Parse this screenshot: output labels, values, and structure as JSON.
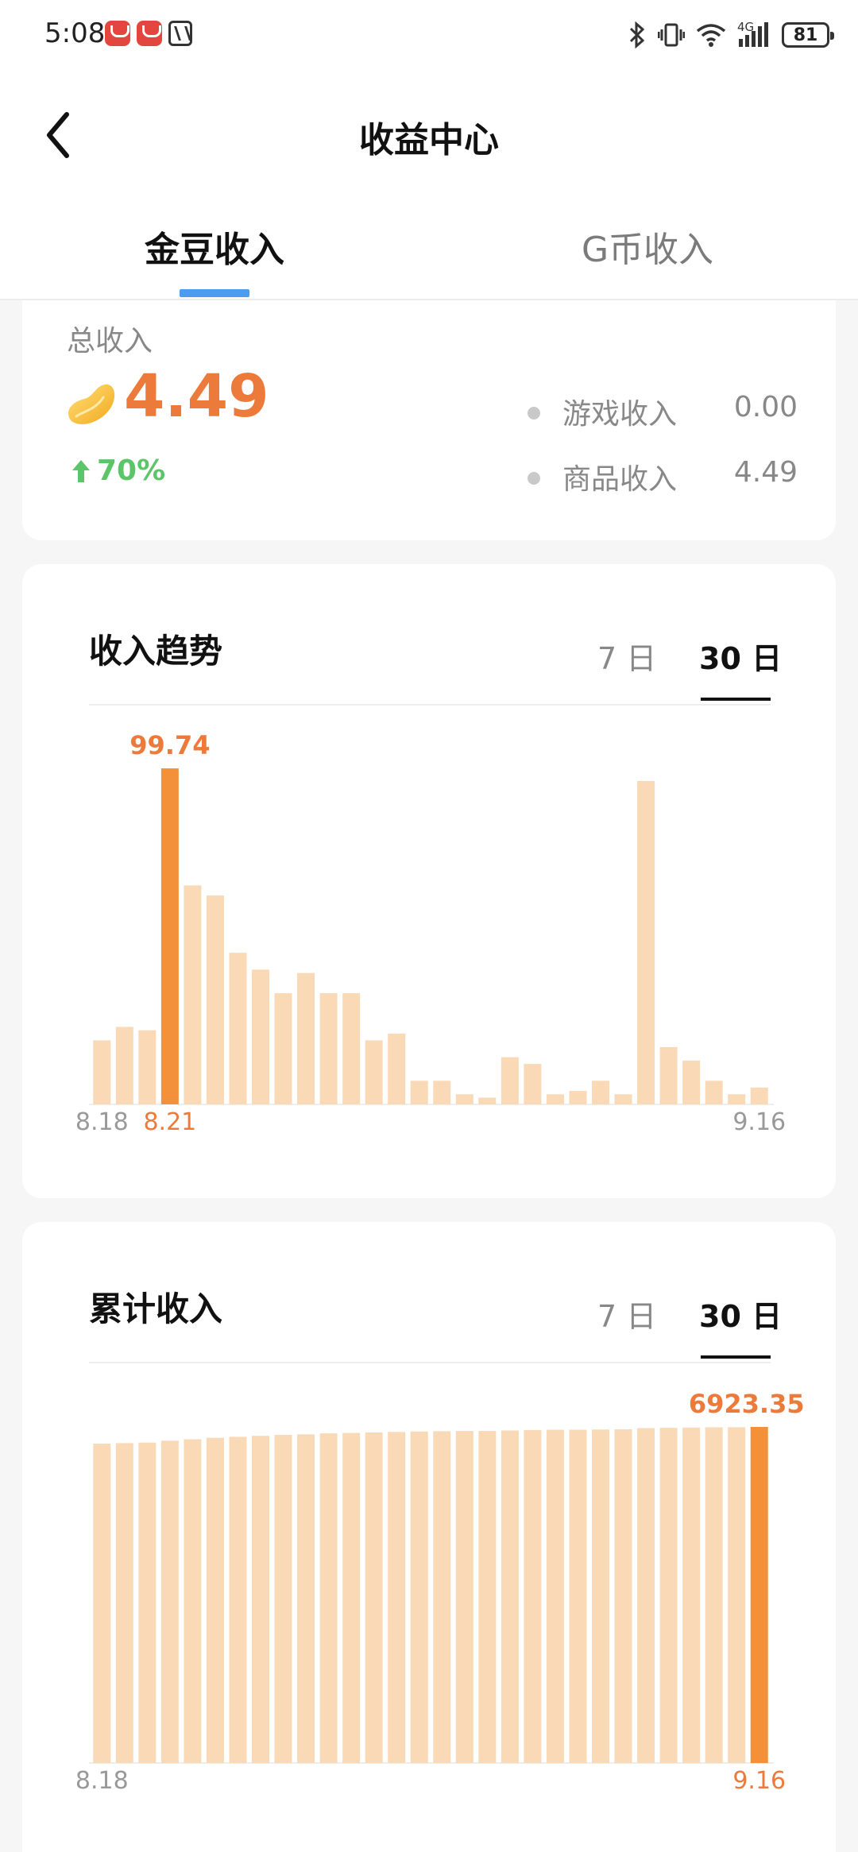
{
  "status_bar": {
    "time": "5:08",
    "network": "4G",
    "battery": "81",
    "icons": [
      "app-icon",
      "app-icon",
      "nfc-icon",
      "bluetooth-icon",
      "vibrate-icon",
      "wifi-icon",
      "signal-icon",
      "battery-icon"
    ]
  },
  "header": {
    "title": "收益中心",
    "back_icon": "chevron-left-icon"
  },
  "tabs": [
    {
      "label": "金豆收入",
      "active": true
    },
    {
      "label": "G币收入",
      "active": false
    }
  ],
  "summary": {
    "total_label": "总收入",
    "total_value": "4.49",
    "growth": "70%",
    "breakdown": [
      {
        "label": "游戏收入",
        "value": "0.00"
      },
      {
        "label": "商品收入",
        "value": "4.49"
      }
    ]
  },
  "trend": {
    "title": "收入趋势",
    "range_options": [
      "7 日",
      "30 日"
    ],
    "selected_range": "30 日"
  },
  "cumulative": {
    "title": "累计收入",
    "range_options": [
      "7 日",
      "30 日"
    ],
    "selected_range": "30 日"
  },
  "colors": {
    "accent": "#ec7a3a",
    "bar_highlight": "#f2913a",
    "bar": "#fad9b6",
    "tab_indicator": "#4a9df0",
    "growth": "#5cc56a"
  },
  "chart_data": [
    {
      "type": "bar",
      "title": "收入趋势",
      "x_start_label": "8.18",
      "x_end_label": "9.16",
      "highlight_index": 3,
      "highlight_label": "8.21",
      "highlight_value_label": "99.74",
      "values": [
        19,
        23,
        22,
        99.74,
        65,
        62,
        45,
        40,
        33,
        39,
        33,
        33,
        19,
        21,
        7,
        7,
        3,
        2,
        14,
        12,
        3,
        4,
        7,
        3,
        96,
        17,
        13,
        7,
        3,
        5
      ],
      "ylim": [
        0,
        100
      ]
    },
    {
      "type": "bar",
      "title": "累计收入",
      "x_start_label": "8.18",
      "x_end_label": "9.16",
      "highlight_index": 29,
      "highlight_value_label": "6923.35",
      "values": [
        6580,
        6590,
        6600,
        6640,
        6670,
        6700,
        6720,
        6740,
        6760,
        6770,
        6790,
        6800,
        6810,
        6820,
        6830,
        6835,
        6840,
        6840,
        6850,
        6860,
        6865,
        6865,
        6870,
        6875,
        6900,
        6905,
        6910,
        6915,
        6918,
        6923.35
      ],
      "ylim": [
        0,
        6923.35
      ]
    }
  ]
}
